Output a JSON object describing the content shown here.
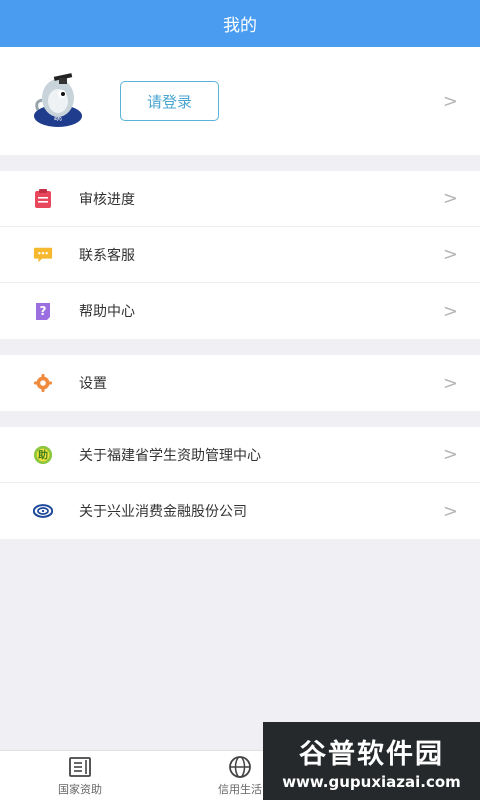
{
  "header": {
    "title": "我的"
  },
  "profile": {
    "login_label": "请登录",
    "chevron": ">"
  },
  "groups": [
    {
      "items": [
        {
          "label": "审核进度",
          "icon": "clipboard-icon",
          "chevron": ">"
        },
        {
          "label": "联系客服",
          "icon": "chat-bubble-icon",
          "chevron": ">"
        },
        {
          "label": "帮助中心",
          "icon": "question-icon",
          "chevron": ">"
        }
      ]
    },
    {
      "items": [
        {
          "label": "设置",
          "icon": "gear-icon",
          "chevron": ">"
        }
      ]
    },
    {
      "items": [
        {
          "label": "关于福建省学生资助管理中心",
          "icon": "fujian-aid-logo-icon",
          "chevron": ">"
        },
        {
          "label": "关于兴业消费金融股份公司",
          "icon": "cib-logo-icon",
          "chevron": ">"
        }
      ]
    }
  ],
  "tabbar": [
    {
      "label": "国家资助",
      "icon": "book-icon"
    },
    {
      "label": "信用生活",
      "icon": "globe-icon"
    },
    {
      "label": "",
      "icon": "person-icon"
    }
  ],
  "watermark": {
    "title": "谷普软件园",
    "url": "www.gupuxiazai.com"
  },
  "colors": {
    "header": "#4a9cf0",
    "login_border": "#5ab2d8",
    "background": "#efeff4"
  }
}
